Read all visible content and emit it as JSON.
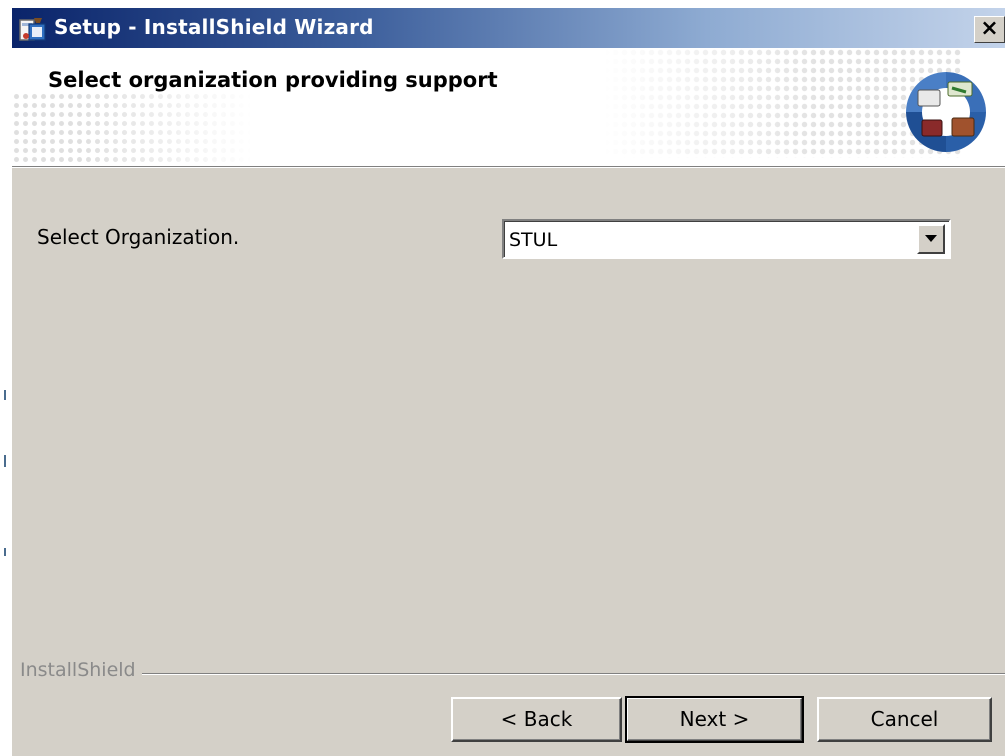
{
  "window": {
    "title": "Setup - InstallShield Wizard",
    "close_glyph": "×",
    "icon": "setup-app-icon"
  },
  "header": {
    "title": "Select organization providing support",
    "logo_icon": "wizard-logo-icon"
  },
  "form": {
    "organization_label": "Select Organization.",
    "organization_value": "STUL"
  },
  "footer": {
    "brand": "InstallShield",
    "buttons": {
      "back": "< Back",
      "next": "Next >",
      "cancel": "Cancel"
    }
  },
  "colors": {
    "titlebar_start": "#0a246a",
    "titlebar_end": "#c3d3ea",
    "dialog_bg": "#d4d0c8",
    "logo_blue": "#2a5fa8"
  }
}
